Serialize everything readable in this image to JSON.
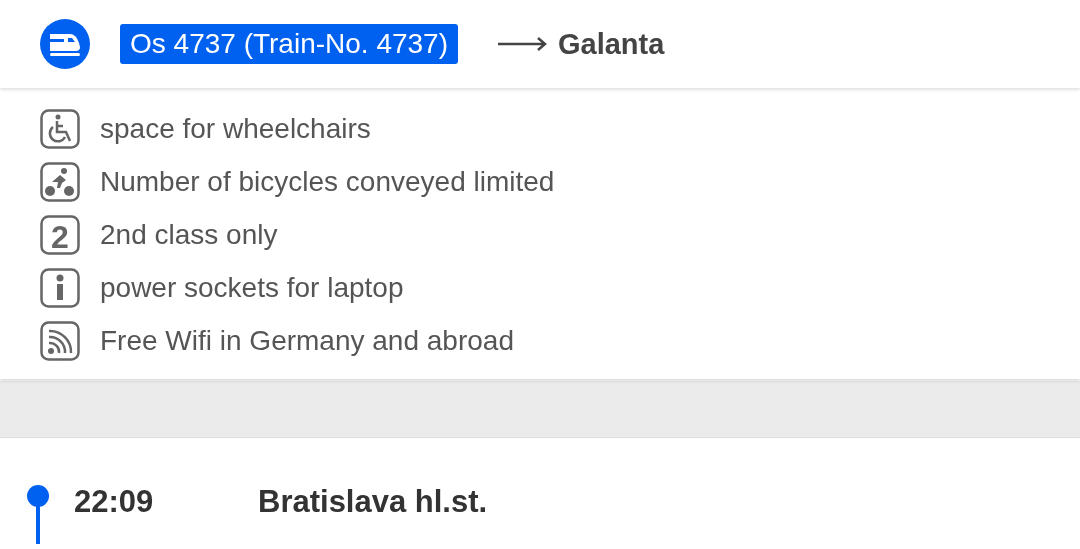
{
  "header": {
    "train": "Os 4737 (Train-No. 4737)",
    "destination": "Galanta"
  },
  "notes": [
    {
      "kind": "wheelchair",
      "text": "space for wheelchairs"
    },
    {
      "kind": "bicycle",
      "text": "Number of bicycles conveyed limited"
    },
    {
      "kind": "class",
      "badge": "2",
      "text": "2nd class only"
    },
    {
      "kind": "info",
      "text": "power sockets for laptop"
    },
    {
      "kind": "wifi",
      "text": "Free Wifi in Germany and abroad"
    }
  ],
  "stops": [
    {
      "time": "22:09",
      "station": "Bratislava hl.st."
    }
  ]
}
